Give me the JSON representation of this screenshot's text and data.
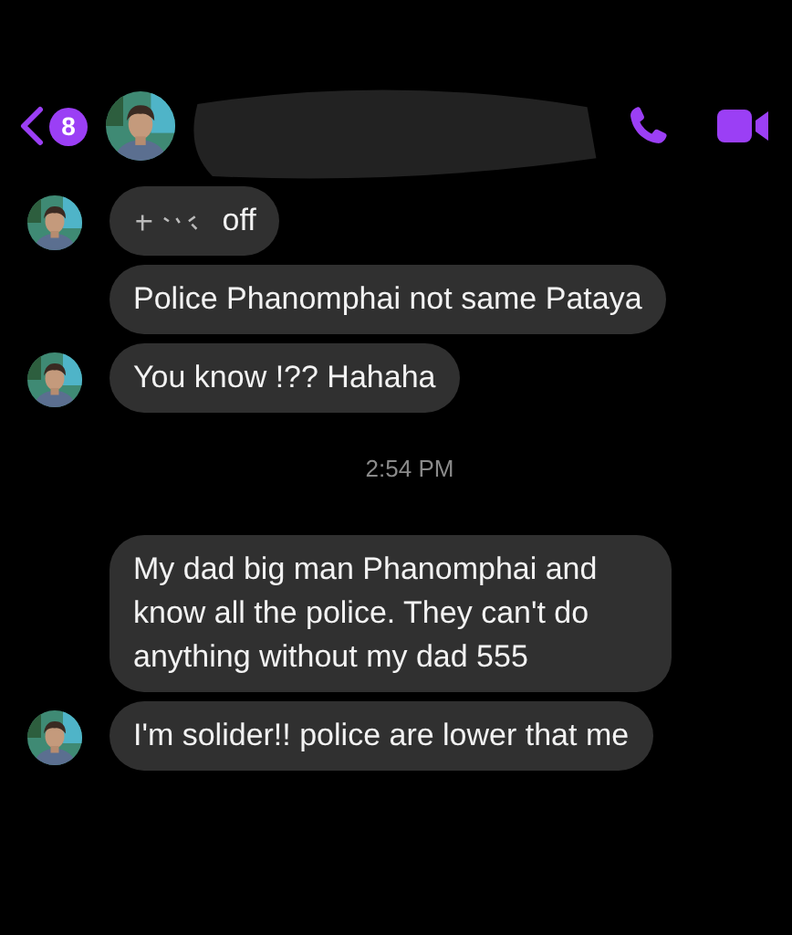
{
  "header": {
    "back_badge": "8",
    "name_redacted": true
  },
  "messages": [
    {
      "kind": "bubble",
      "text": "off",
      "redacted_prefix": true,
      "avatar": true
    },
    {
      "kind": "bubble",
      "text": "Police Phanomphai not same Pataya",
      "redacted_prefix": false,
      "avatar": false
    },
    {
      "kind": "bubble",
      "text": "You know !?? Hahaha",
      "redacted_prefix": false,
      "avatar": true
    },
    {
      "kind": "timestamp",
      "text": "2:54 PM"
    },
    {
      "kind": "bubble",
      "text": "My dad big man Phanomphai and know all the police. They can't do anything without my dad 555",
      "redacted_prefix": false,
      "avatar": false
    },
    {
      "kind": "bubble",
      "text": "I'm solider!! police are lower that me",
      "redacted_prefix": false,
      "avatar": true
    }
  ]
}
